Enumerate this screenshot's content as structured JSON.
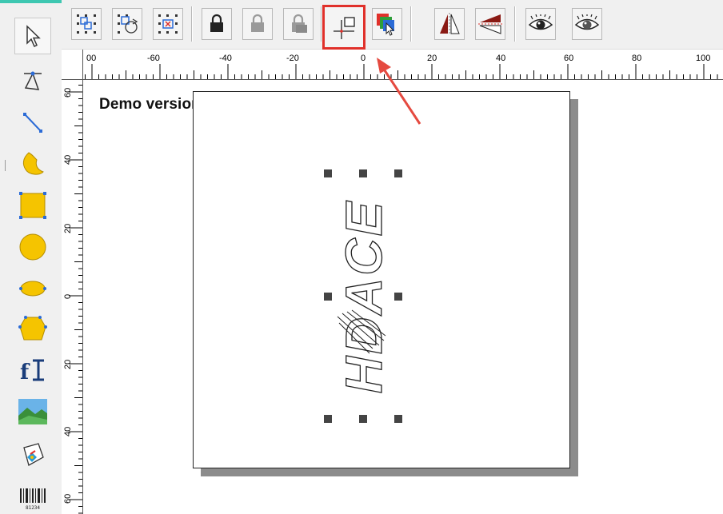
{
  "canvas": {
    "demo_notice": "Demo version-only for evaluation",
    "logo_text": "HDACE"
  },
  "rulers": {
    "horizontal_labels": [
      "00",
      "-60",
      "-40",
      "-20",
      "0",
      "20",
      "40",
      "60",
      "80",
      "100"
    ],
    "vertical_labels": [
      "60",
      "40",
      "20",
      "0",
      "20",
      "40",
      "60"
    ]
  },
  "toolbox": {
    "tools": [
      {
        "name": "select-tool",
        "icon": "arrow-pointer-icon"
      },
      {
        "name": "node-edit-tool",
        "icon": "node-edit-icon"
      },
      {
        "name": "line-tool",
        "icon": "line-icon"
      },
      {
        "name": "curve-tool",
        "icon": "curve-icon"
      },
      {
        "name": "rectangle-tool",
        "icon": "rectangle-icon"
      },
      {
        "name": "circle-tool",
        "icon": "circle-icon"
      },
      {
        "name": "ellipse-tool",
        "icon": "ellipse-icon"
      },
      {
        "name": "polygon-tool",
        "icon": "polygon-icon"
      },
      {
        "name": "text-tool",
        "icon": "text-icon"
      },
      {
        "name": "image-tool",
        "icon": "image-icon"
      },
      {
        "name": "vector-file-tool",
        "icon": "vector-file-icon"
      },
      {
        "name": "barcode-tool",
        "icon": "barcode-icon"
      }
    ],
    "barcode_caption": "81234"
  },
  "toolbar": {
    "buttons": [
      {
        "name": "group-button",
        "icon": "group-icon"
      },
      {
        "name": "ungroup-rotate-button",
        "icon": "rotate-group-icon"
      },
      {
        "name": "delete-group-button",
        "icon": "delete-group-icon"
      },
      {
        "name": "lock-button",
        "icon": "lock-icon"
      },
      {
        "name": "unlock-button",
        "icon": "unlock-icon"
      },
      {
        "name": "unlock-all-button",
        "icon": "unlock-all-icon"
      },
      {
        "name": "set-origin-button",
        "icon": "origin-icon",
        "highlighted": true
      },
      {
        "name": "layer-order-button",
        "icon": "layers-icon"
      },
      {
        "name": "mirror-horizontal-button",
        "icon": "mirror-horizontal-icon"
      },
      {
        "name": "mirror-vertical-button",
        "icon": "mirror-vertical-icon"
      },
      {
        "name": "show-hide-button",
        "icon": "eye-icon"
      },
      {
        "name": "show-all-button",
        "icon": "eye-all-icon"
      }
    ]
  },
  "colors": {
    "highlight_border": "#e0302a",
    "arrow": "#e54a40",
    "tool_yellow": "#f5c400",
    "tool_blue": "#2b6bd6"
  }
}
